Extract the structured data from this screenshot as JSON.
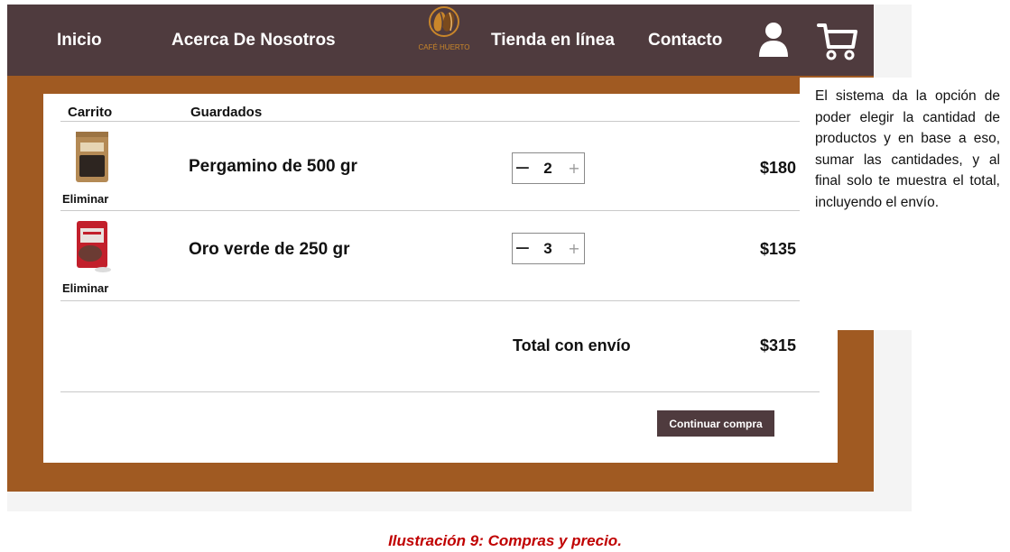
{
  "nav": {
    "items": [
      "Inicio",
      "Acerca De Nosotros",
      "Tienda en línea",
      "Contacto"
    ],
    "logo_text": "CAFÉ HUERTO",
    "icons": [
      "user-icon",
      "cart-icon"
    ]
  },
  "cart": {
    "tabs": [
      "Carrito",
      "Guardados"
    ],
    "items": [
      {
        "name": "Pergamino de 500 gr",
        "quantity": "2",
        "price": "$180",
        "remove_label": "Eliminar"
      },
      {
        "name": "Oro verde de 250 gr",
        "quantity": "3",
        "price": "$135",
        "remove_label": "Eliminar"
      }
    ],
    "total_label": "Total con envío",
    "total_value": "$315",
    "continue_label": "Continuar compra"
  },
  "note": {
    "text": "El sistema da la opción de poder elegir la cantidad de productos y en base a eso, sumar las cantidades, y al final solo te muestra el total, incluyendo el envío."
  },
  "caption": "Ilustración 9: Compras y precio.",
  "colors": {
    "nav_bg": "#4f3b3e",
    "frame_brown": "#a05a22",
    "button_bg": "#4f3b3e",
    "caption": "#c00000"
  }
}
